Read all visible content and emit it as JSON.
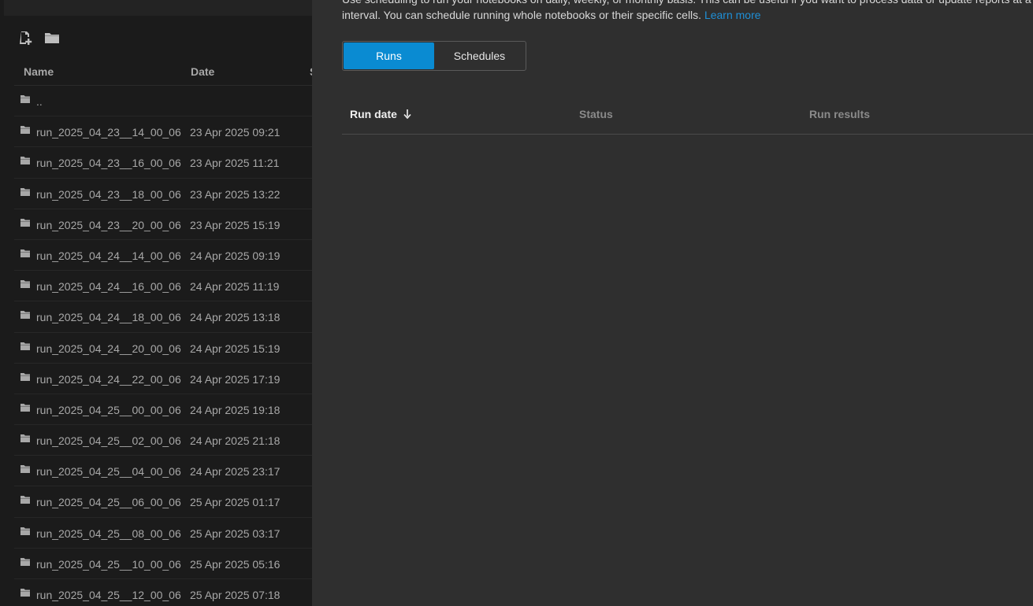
{
  "file_browser": {
    "columns": {
      "name": "Name",
      "date": "Date",
      "size_partial": "S"
    },
    "toolbar": {
      "new_file_icon": "new-file-icon",
      "new_folder_icon": "new-folder-icon"
    },
    "rows": [
      {
        "name": "..",
        "date": ""
      },
      {
        "name": "run_2025_04_23__14_00_06",
        "date": "23 Apr 2025 09:21"
      },
      {
        "name": "run_2025_04_23__16_00_06",
        "date": "23 Apr 2025 11:21"
      },
      {
        "name": "run_2025_04_23__18_00_06",
        "date": "23 Apr 2025 13:22"
      },
      {
        "name": "run_2025_04_23__20_00_06",
        "date": "23 Apr 2025 15:19"
      },
      {
        "name": "run_2025_04_24__14_00_06",
        "date": "24 Apr 2025 09:19"
      },
      {
        "name": "run_2025_04_24__16_00_06",
        "date": "24 Apr 2025 11:19"
      },
      {
        "name": "run_2025_04_24__18_00_06",
        "date": "24 Apr 2025 13:18"
      },
      {
        "name": "run_2025_04_24__20_00_06",
        "date": "24 Apr 2025 15:19"
      },
      {
        "name": "run_2025_04_24__22_00_06",
        "date": "24 Apr 2025 17:19"
      },
      {
        "name": "run_2025_04_25__00_00_06",
        "date": "24 Apr 2025 19:18"
      },
      {
        "name": "run_2025_04_25__02_00_06",
        "date": "24 Apr 2025 21:18"
      },
      {
        "name": "run_2025_04_25__04_00_06",
        "date": "24 Apr 2025 23:17"
      },
      {
        "name": "run_2025_04_25__06_00_06",
        "date": "25 Apr 2025 01:17"
      },
      {
        "name": "run_2025_04_25__08_00_06",
        "date": "25 Apr 2025 03:17"
      },
      {
        "name": "run_2025_04_25__10_00_06",
        "date": "25 Apr 2025 05:16"
      },
      {
        "name": "run_2025_04_25__12_00_06",
        "date": "25 Apr 2025 07:18"
      }
    ]
  },
  "scheduling": {
    "description_line1": "Use scheduling to run your notebooks on daily, weekly, or monthly basis. This can be useful if you want to process data or update reports at a specific",
    "description_line2": "interval. You can schedule running whole notebooks or their specific cells.",
    "learn_more": "Learn more",
    "tabs": [
      {
        "label": "Runs",
        "active": true
      },
      {
        "label": "Schedules",
        "active": false
      }
    ],
    "table": {
      "columns": [
        "Run date",
        "Status",
        "Run results"
      ],
      "sort_icon": "arrow-down-icon"
    }
  },
  "colors": {
    "accent": "#0a8bd2",
    "link": "#1f8fd6",
    "panel_bg": "#2f2f2f",
    "sidebar_bg": "#1b1b1b"
  }
}
